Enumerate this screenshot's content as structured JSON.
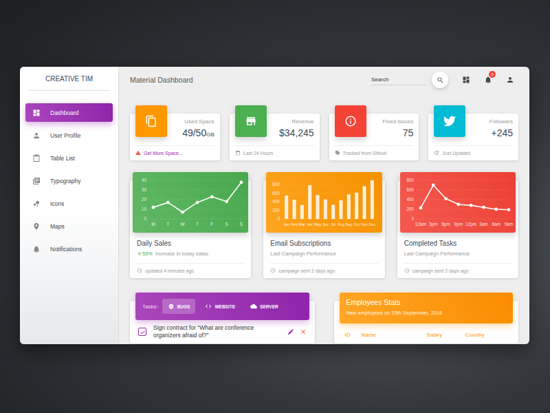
{
  "sidebar": {
    "logo": "CREATIVE TIM",
    "items": [
      {
        "label": "Dashboard",
        "selected": true
      },
      {
        "label": "User Profile",
        "selected": false
      },
      {
        "label": "Table List",
        "selected": false
      },
      {
        "label": "Typography",
        "selected": false
      },
      {
        "label": "Icons",
        "selected": false
      },
      {
        "label": "Maps",
        "selected": false
      },
      {
        "label": "Notifications",
        "selected": false
      }
    ]
  },
  "navbar": {
    "title": "Material Dashboard",
    "search": {
      "placeholder": "Search"
    },
    "notifications": "5"
  },
  "stats": [
    {
      "category": "Used Space",
      "value": "49/50",
      "unit": "GB",
      "footer": "Get More Space...",
      "warning": true,
      "color": "#ff9800"
    },
    {
      "category": "Revenue",
      "value": "$34,245",
      "footer": "Last 24 Hours",
      "warning": false,
      "color": "#4caf50"
    },
    {
      "category": "Fixed Issues",
      "value": "75",
      "footer": "Tracked from Github",
      "warning": false,
      "color": "#f44336"
    },
    {
      "category": "Followers",
      "value": "+245",
      "footer": "Just Updated",
      "warning": false,
      "color": "#00bcd4"
    }
  ],
  "charts": [
    {
      "title": "Daily Sales",
      "kind": "line",
      "color": "#4caf50",
      "ticks": [
        "0",
        "10",
        "20",
        "30",
        "40"
      ],
      "labels": [
        "M",
        "T",
        "W",
        "T",
        "F",
        "S",
        "S"
      ],
      "values": [
        12,
        17,
        7,
        17,
        23,
        18,
        38
      ],
      "highlight": "55%",
      "subtitle": "increase in today sales.",
      "footer": "updated 4 minutes ago"
    },
    {
      "title": "Email Subscriptions",
      "kind": "bar",
      "color": "#ff9800",
      "ticks": [
        "0",
        "200",
        "400",
        "600",
        "800"
      ],
      "labels": [
        "Jan",
        "Feb",
        "Mar",
        "Apr",
        "May",
        "Jun",
        "Jul",
        "Aug",
        "Sep",
        "Oct",
        "Nov",
        "Dec"
      ],
      "values": [
        542,
        443,
        320,
        780,
        553,
        453,
        326,
        434,
        568,
        610,
        756,
        895
      ],
      "subtitle": "Last Campaign Performance",
      "footer": "campaign sent 2 days ago"
    },
    {
      "title": "Completed Tasks",
      "kind": "line",
      "color": "#f44336",
      "ticks": [
        "0",
        "200",
        "400",
        "600",
        "800"
      ],
      "labels": [
        "12am",
        "3pm",
        "6pm",
        "9pm",
        "12pm",
        "3am",
        "6am",
        "9am"
      ],
      "values": [
        230,
        700,
        420,
        300,
        280,
        240,
        200,
        190
      ],
      "subtitle": "Last Campaign Performance",
      "footer": "campaign sent 2 days ago"
    }
  ],
  "tasks": {
    "label": "Tasks:",
    "tabs": [
      {
        "label": "BUGS",
        "selected": true
      },
      {
        "label": "WEBSITE",
        "selected": false
      },
      {
        "label": "SERVER",
        "selected": false
      }
    ],
    "items": [
      {
        "text": "Sign contract for \"What are conference organizers afraid of?\"",
        "checked": true
      }
    ]
  },
  "employees": {
    "title": "Employees Stats",
    "subtitle": "New employees on 15th September, 2016",
    "columns": [
      "ID",
      "Name",
      "Salary",
      "Country"
    ]
  }
}
